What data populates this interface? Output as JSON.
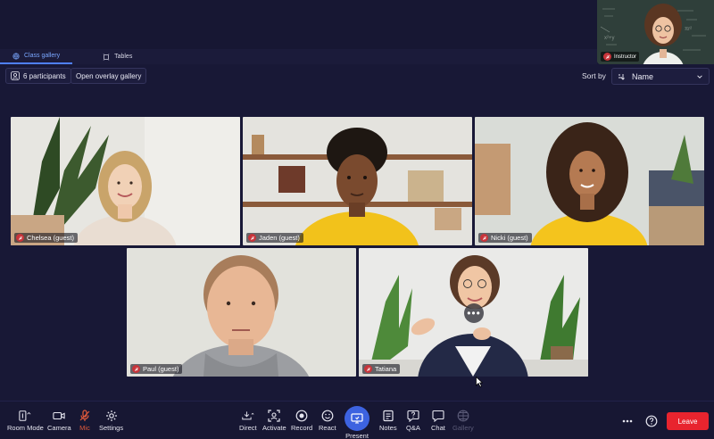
{
  "header": {
    "instructor_label": "Instructor"
  },
  "tabs": [
    {
      "label": "Class gallery",
      "active": true
    },
    {
      "label": "Tables",
      "active": false
    }
  ],
  "controls": {
    "participants_label": "6 participants",
    "overlay_label": "Open overlay gallery",
    "sort_label": "Sort by",
    "sort_value": "Name"
  },
  "tiles": [
    {
      "name": "Chelsea (guest)",
      "muted": true
    },
    {
      "name": "Jaden (guest)",
      "muted": true
    },
    {
      "name": "Nicki (guest)",
      "muted": true
    },
    {
      "name": "Paul (guest)",
      "muted": true
    },
    {
      "name": "Tatiana",
      "muted": true
    }
  ],
  "toolbar": {
    "left": [
      "Room Mode",
      "Camera",
      "Mic",
      "Settings"
    ],
    "center": [
      "Direct",
      "Activate",
      "Record",
      "React",
      "Present",
      "Notes",
      "Q&A",
      "Chat",
      "Gallery"
    ],
    "leave_label": "Leave"
  },
  "colors": {
    "background": "#181836",
    "accent": "#3d63e0",
    "muted_red": "#c8343a",
    "leave_red": "#e8242e"
  }
}
